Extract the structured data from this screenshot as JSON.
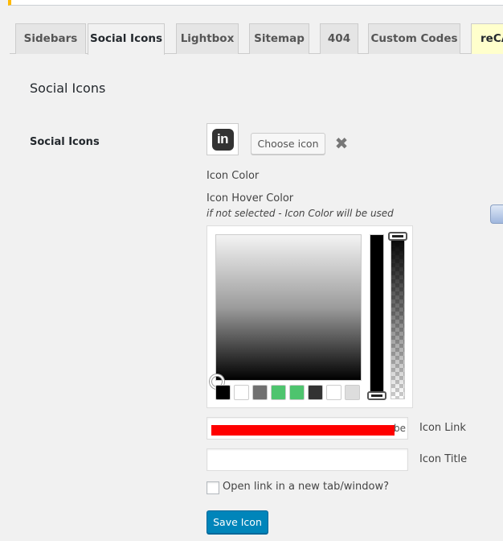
{
  "tabs": [
    {
      "label": "Sidebars",
      "active": false
    },
    {
      "label": "Social Icons",
      "active": true
    },
    {
      "label": "Lightbox",
      "active": false
    },
    {
      "label": "Sitemap",
      "active": false
    },
    {
      "label": "404",
      "active": false
    },
    {
      "label": "Custom Codes",
      "active": false
    },
    {
      "label": "reCAPTCHA",
      "active": false
    }
  ],
  "section_title": "Social Icons",
  "field_label": "Social Icons",
  "icon": {
    "name": "linkedin-icon",
    "glyph": "in"
  },
  "choose_icon_label": "Choose icon",
  "remove_glyph": "✖",
  "icon_color_label": "Icon Color",
  "icon_hover_color_label": "Icon Hover Color",
  "icon_hover_hint": "if not selected - Icon Color will be used",
  "color_picker": {
    "palette": [
      "#000000",
      "#ffffff",
      "#707070",
      "#4ec46e",
      "#4ec46e",
      "#333333",
      "#ffffff",
      "#dddddd"
    ]
  },
  "icon_link": {
    "label": "Icon Link",
    "value_tail": "be",
    "placeholder": ""
  },
  "icon_title": {
    "label": "Icon Title",
    "value": "",
    "placeholder": ""
  },
  "new_tab_checkbox": {
    "label": "Open link in a new tab/window?",
    "checked": false
  },
  "save_button": "Save Icon",
  "colors": {
    "accent": "#0085ba",
    "redaction": "#ff0000",
    "tab_highlight": "#ffffcc"
  }
}
